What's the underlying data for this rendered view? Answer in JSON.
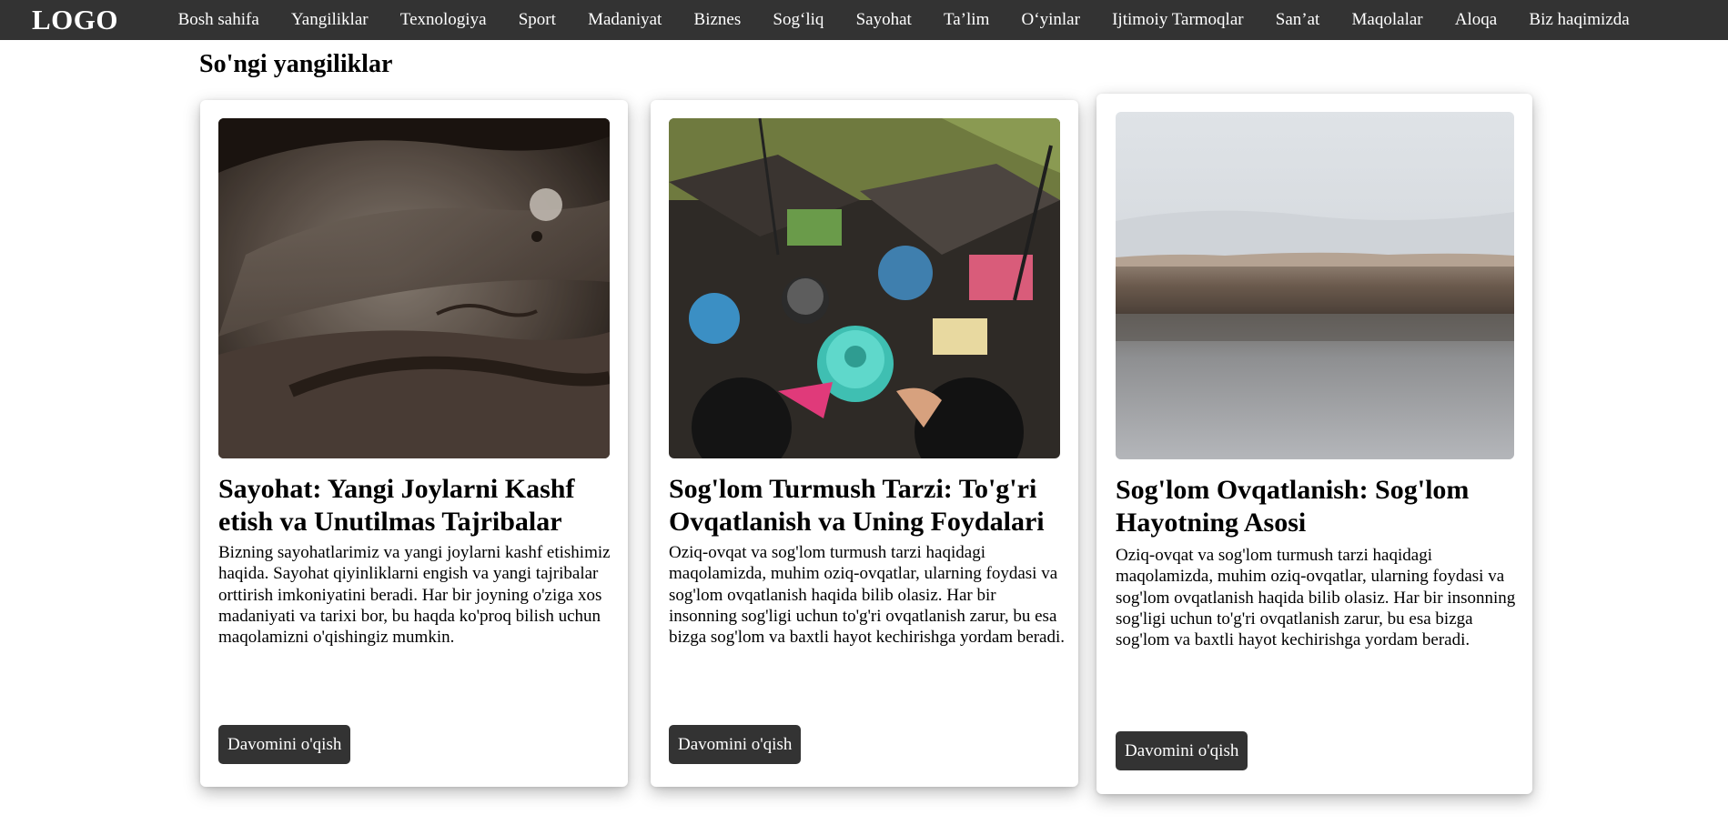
{
  "nav": {
    "logo": "LOGO",
    "items": [
      {
        "label": "Bosh sahifa"
      },
      {
        "label": "Yangiliklar"
      },
      {
        "label": "Texnologiya"
      },
      {
        "label": "Sport"
      },
      {
        "label": "Madaniyat"
      },
      {
        "label": "Biznes"
      },
      {
        "label": "Sog‘liq"
      },
      {
        "label": "Sayohat"
      },
      {
        "label": "Ta’lim"
      },
      {
        "label": "O‘yinlar"
      },
      {
        "label": "Ijtimoiy Tarmoqlar"
      },
      {
        "label": "San’at"
      },
      {
        "label": "Maqolalar"
      },
      {
        "label": "Aloqa"
      },
      {
        "label": "Biz haqimizda"
      }
    ]
  },
  "main": {
    "section_title": "So'ngi yangiliklar",
    "cards": [
      {
        "image": "vintage-car-photo",
        "title": "Sayohat: Yangi Joylarni Kashf etish va Unutilmas Tajribalar",
        "text": "Bizning sayohatlarimiz va yangi joylarni kashf etishimiz haqida. Sayohat qiyinliklarni engish va yangi tajribalar orttirish imkoniyatini beradi. Har bir joyning o'ziga xos madaniyati va tarixi bor, bu haqda ko'proq bilish uchun maqolamizni o'qishingiz mumkin.",
        "button": "Davomini o'qish"
      },
      {
        "image": "floating-market-photo",
        "title": "Sog'lom Turmush Tarzi: To'g'ri Ovqatlanish va Uning Foydalari",
        "text": "Oziq-ovqat va sog'lom turmush tarzi haqidagi maqolamizda, muhim oziq-ovqatlar, ularning foydasi va sog'lom ovqatlanish haqida bilib olasiz. Har bir insonning sog'ligi uchun to'g'ri ovqatlanish zarur, bu esa bizga sog'lom va baxtli hayot kechirishga yordam beradi.",
        "button": "Davomini o'qish"
      },
      {
        "image": "rocky-shore-lake-photo",
        "title": "Sog'lom Ovqatlanish: Sog'lom Hayotning Asosi",
        "text": "Oziq-ovqat va sog'lom turmush tarzi haqidagi maqolamizda, muhim oziq-ovqatlar, ularning foydasi va sog'lom ovqatlanish haqida bilib olasiz. Har bir insonning sog'ligi uchun to'g'ri ovqatlanish zarur, bu esa bizga sog'lom va baxtli hayot kechirishga yordam beradi.",
        "button": "Davomini o'qish"
      }
    ]
  }
}
